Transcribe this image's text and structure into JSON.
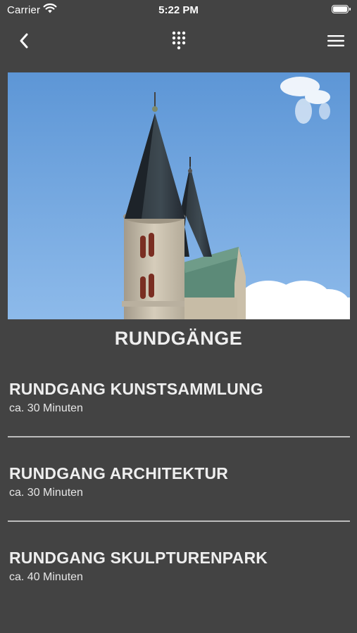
{
  "status_bar": {
    "carrier": "Carrier",
    "time": "5:22 PM"
  },
  "nav": {
    "back_icon": "chevron-left-icon",
    "center_icon": "keypad-icon",
    "menu_icon": "hamburger-menu-icon"
  },
  "hero": {
    "subject": "church-towers-photo"
  },
  "section_title": "RUNDGÄNGE",
  "tours": [
    {
      "name": "RUNDGANG KUNSTSAMMLUNG",
      "duration": "ca. 30 Minuten"
    },
    {
      "name": "RUNDGANG ARCHITEKTUR",
      "duration": "ca. 30 Minuten"
    },
    {
      "name": "RUNDGANG SKULPTURENPARK",
      "duration": "ca. 40 Minuten"
    }
  ],
  "colors": {
    "background": "#434343",
    "text": "#eeeeee",
    "divider": "#bdbdbd"
  }
}
